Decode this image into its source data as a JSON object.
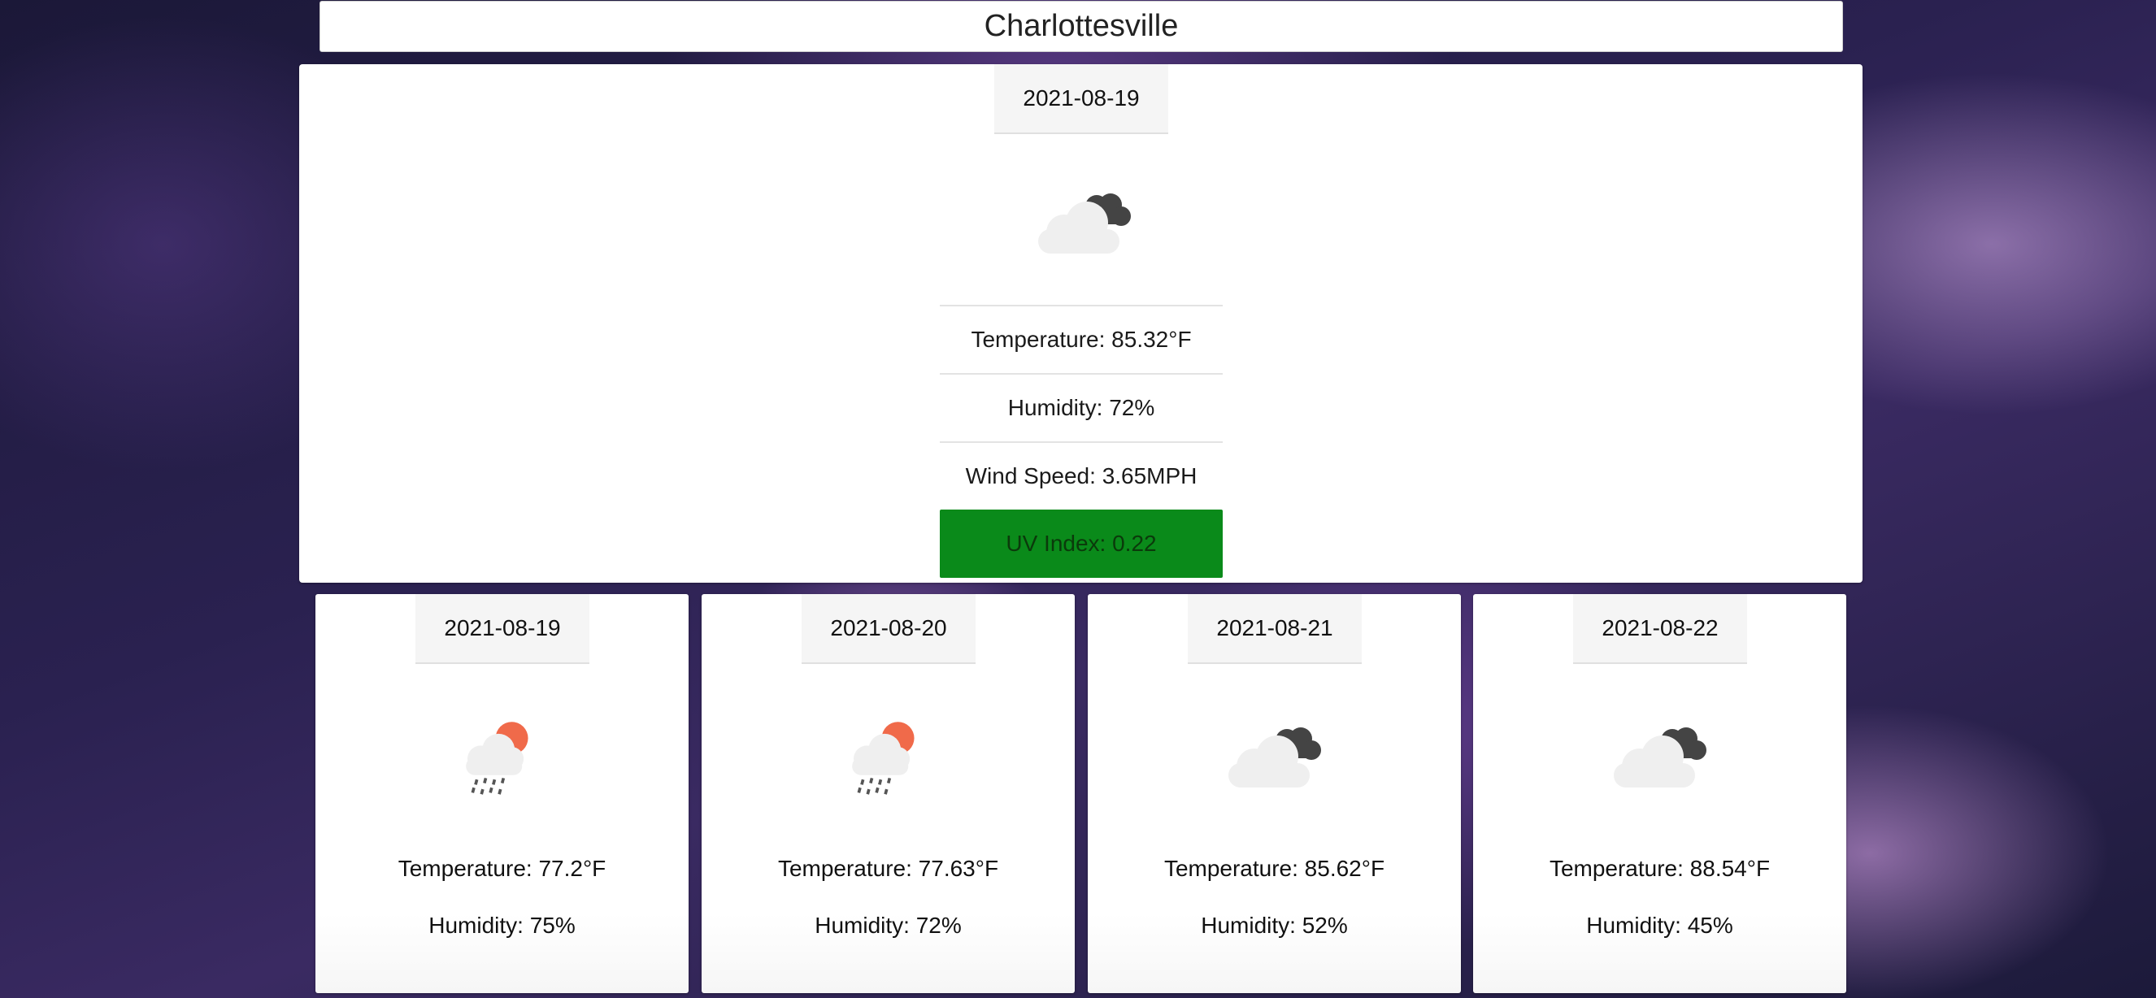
{
  "city": "Charlottesville",
  "current": {
    "date": "2021-08-19",
    "icon": "cloudy-night-icon",
    "temperature": "Temperature: 85.32°F",
    "humidity": "Humidity: 72%",
    "wind_speed": "Wind Speed: 3.65MPH",
    "uv_index": "UV Index: 0.22",
    "uv_color": "#0a8a1a"
  },
  "forecast": [
    {
      "date": "2021-08-19",
      "icon": "rain-sun-icon",
      "temperature": "Temperature: 77.2°F",
      "humidity": "Humidity: 75%"
    },
    {
      "date": "2021-08-20",
      "icon": "rain-sun-icon",
      "temperature": "Temperature: 77.63°F",
      "humidity": "Humidity: 72%"
    },
    {
      "date": "2021-08-21",
      "icon": "cloudy-night-icon",
      "temperature": "Temperature: 85.62°F",
      "humidity": "Humidity: 52%"
    },
    {
      "date": "2021-08-22",
      "icon": "cloudy-night-icon",
      "temperature": "Temperature: 88.54°F",
      "humidity": "Humidity: 45%"
    }
  ]
}
